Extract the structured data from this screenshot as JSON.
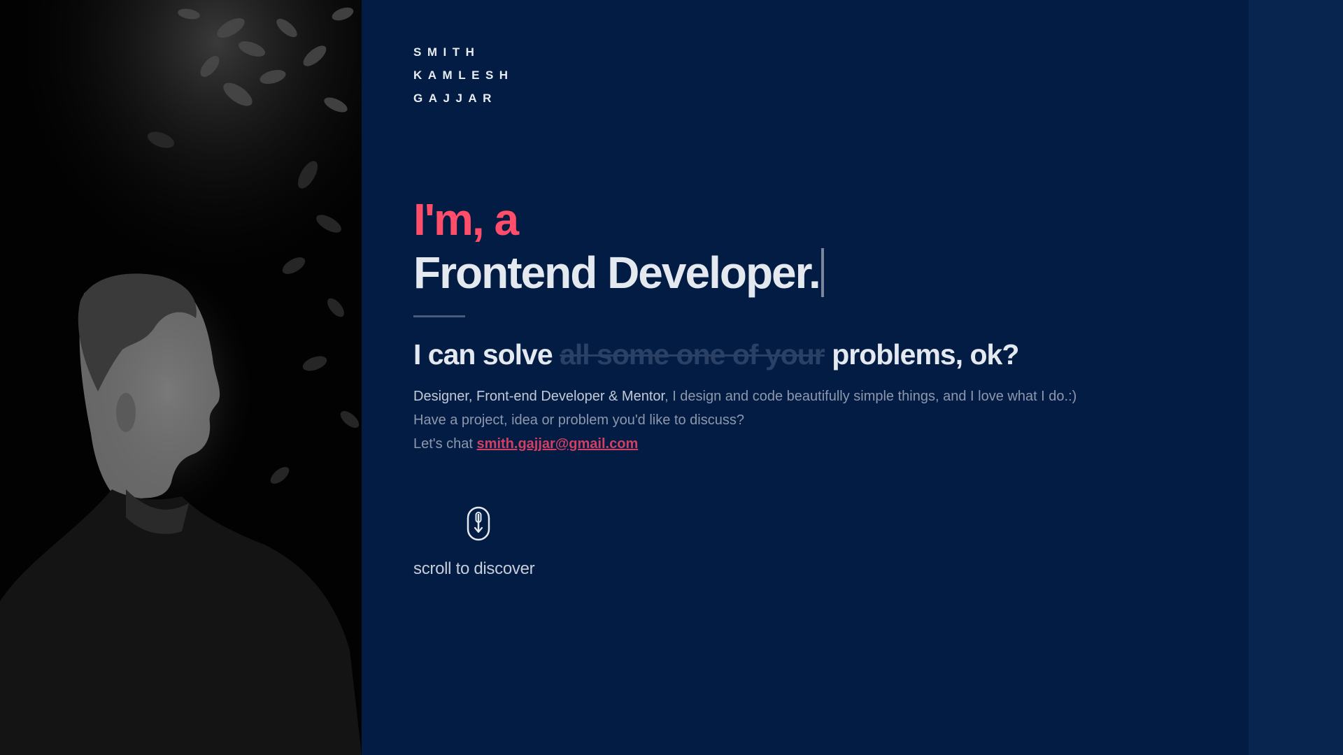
{
  "brand": {
    "name_lines": [
      "SMITH",
      "KAMLESH",
      "GAJJAR"
    ]
  },
  "hero": {
    "intro": "I'm, a",
    "role": "Frontend Developer."
  },
  "tagline": {
    "before": "I can solve",
    "struck": "all some one of your",
    "after": "problems, ok?"
  },
  "description": {
    "highlight": "Designer, Front-end Developer & Mentor",
    "line1_rest": ", I design and code beautifully simple things, and I love what I do.:)",
    "line2": "Have a project, idea or problem you'd like to discuss?",
    "line3_prefix": "Let's chat",
    "email": "smith.gajjar@gmail.com"
  },
  "scroll": {
    "icon": "mouse-scroll-icon",
    "label": "scroll to discover"
  },
  "colors": {
    "background": "#021c44",
    "accent": "#ff4d6a",
    "link": "#d33f62",
    "text": "#e4e8ef",
    "muted": "#8d98ad"
  }
}
